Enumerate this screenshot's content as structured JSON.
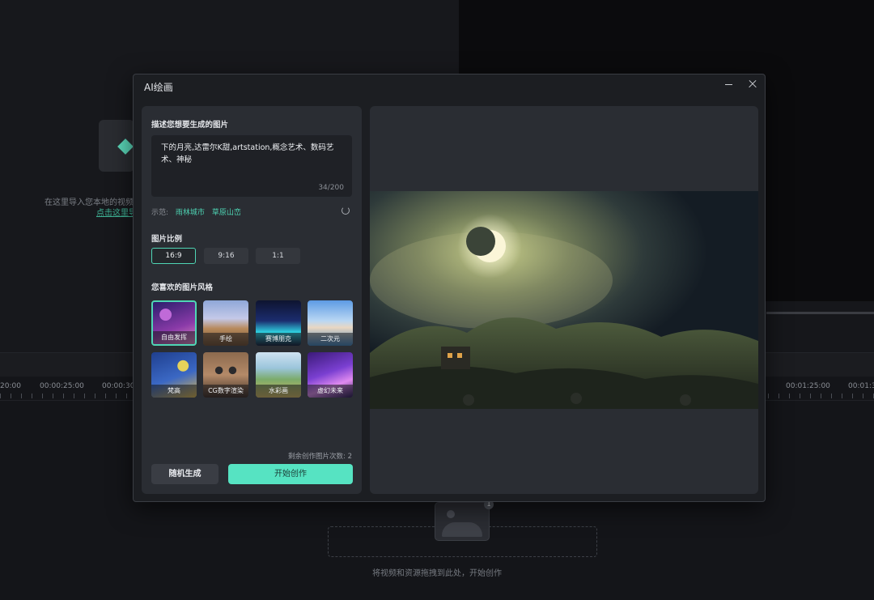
{
  "background": {
    "import_text": "在这里导入您本地的视频、",
    "import_link": "点击这里导",
    "ruler": [
      "20:00",
      "00:00:25:00",
      "00:00:30",
      "00:01:25:00",
      "00:01:3"
    ],
    "drop_text": "将视频和资源拖拽到此处，开始创作",
    "drop_badge": "1"
  },
  "dialog": {
    "title": "AI绘画",
    "prompt_label": "描述您想要生成的图片",
    "prompt_text": "下的月亮,达雷尔K甜,artstation,概念艺术、数码艺术、神秘",
    "prompt_count": "34/200",
    "examples_label": "示范:",
    "examples": [
      "雨林城市",
      "草原山峦"
    ],
    "ratio_label": "图片比例",
    "ratios": [
      {
        "label": "16:9",
        "active": true
      },
      {
        "label": "9:16",
        "active": false
      },
      {
        "label": "1:1",
        "active": false
      }
    ],
    "style_label": "您喜欢的图片风格",
    "styles": [
      {
        "label": "自由发挥",
        "active": true
      },
      {
        "label": "手绘",
        "active": false
      },
      {
        "label": "赛博朋克",
        "active": false
      },
      {
        "label": "二次元",
        "active": false
      },
      {
        "label": "梵高",
        "active": false
      },
      {
        "label": "CG数字渲染",
        "active": false
      },
      {
        "label": "水彩画",
        "active": false
      },
      {
        "label": "虚幻未来",
        "active": false
      }
    ],
    "remaining": "剩余创作图片次数: 2",
    "random_button": "随机生成",
    "start_button": "开始创作"
  }
}
